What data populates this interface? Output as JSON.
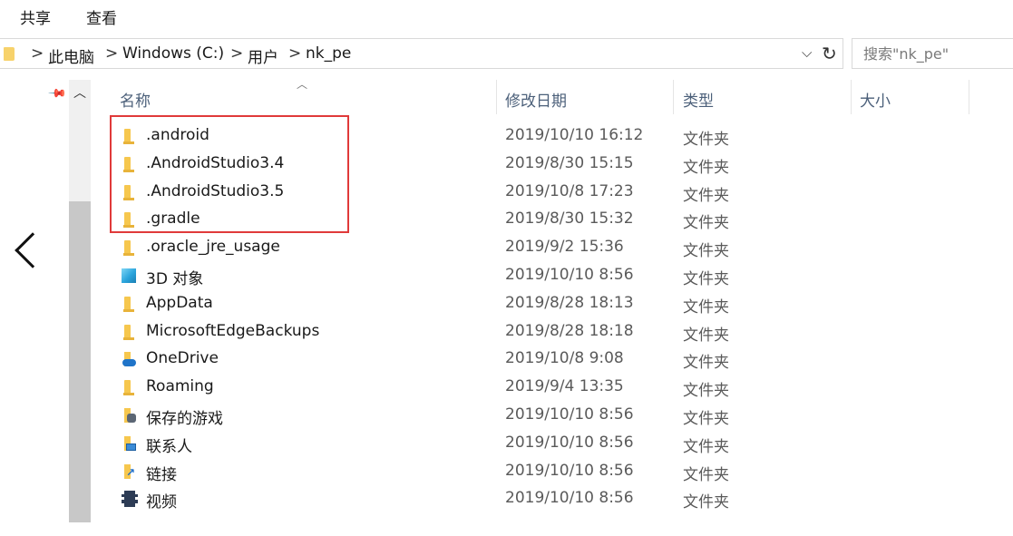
{
  "ribbon": {
    "tabs": [
      "共享",
      "查看"
    ]
  },
  "address": {
    "crumbs": [
      "此电脑",
      "Windows (C:)",
      "用户",
      "nk_pe"
    ],
    "chevron": ">",
    "dropdown_icon": "chevron-down-icon",
    "refresh_icon": "refresh-icon"
  },
  "search": {
    "placeholder": "搜索\"nk_pe\"",
    "icon": "search-icon"
  },
  "columns": {
    "name": "名称",
    "date": "修改日期",
    "type": "类型",
    "size": "大小"
  },
  "files": [
    {
      "name": ".android",
      "date": "2019/10/10 16:12",
      "type": "文件夹",
      "icon": "folder"
    },
    {
      "name": ".AndroidStudio3.4",
      "date": "2019/8/30 15:15",
      "type": "文件夹",
      "icon": "folder"
    },
    {
      "name": ".AndroidStudio3.5",
      "date": "2019/10/8 17:23",
      "type": "文件夹",
      "icon": "folder"
    },
    {
      "name": ".gradle",
      "date": "2019/8/30 15:32",
      "type": "文件夹",
      "icon": "folder"
    },
    {
      "name": ".oracle_jre_usage",
      "date": "2019/9/2 15:36",
      "type": "文件夹",
      "icon": "folder"
    },
    {
      "name": "3D 对象",
      "date": "2019/10/10 8:56",
      "type": "文件夹",
      "icon": "cube"
    },
    {
      "name": "AppData",
      "date": "2019/8/28 18:13",
      "type": "文件夹",
      "icon": "folder"
    },
    {
      "name": "MicrosoftEdgeBackups",
      "date": "2019/8/28 18:18",
      "type": "文件夹",
      "icon": "folder"
    },
    {
      "name": "OneDrive",
      "date": "2019/10/8 9:08",
      "type": "文件夹",
      "icon": "cloud"
    },
    {
      "name": "Roaming",
      "date": "2019/9/4 13:35",
      "type": "文件夹",
      "icon": "folder"
    },
    {
      "name": "保存的游戏",
      "date": "2019/10/10 8:56",
      "type": "文件夹",
      "icon": "game"
    },
    {
      "name": "联系人",
      "date": "2019/10/10 8:56",
      "type": "文件夹",
      "icon": "contact"
    },
    {
      "name": "链接",
      "date": "2019/10/10 8:56",
      "type": "文件夹",
      "icon": "link"
    },
    {
      "name": "视频",
      "date": "2019/10/10 8:56",
      "type": "文件夹",
      "icon": "video"
    }
  ],
  "colors": {
    "selection_outline": "#e03a3a",
    "header_text": "#4c607a",
    "folder": "#f6c74e"
  }
}
